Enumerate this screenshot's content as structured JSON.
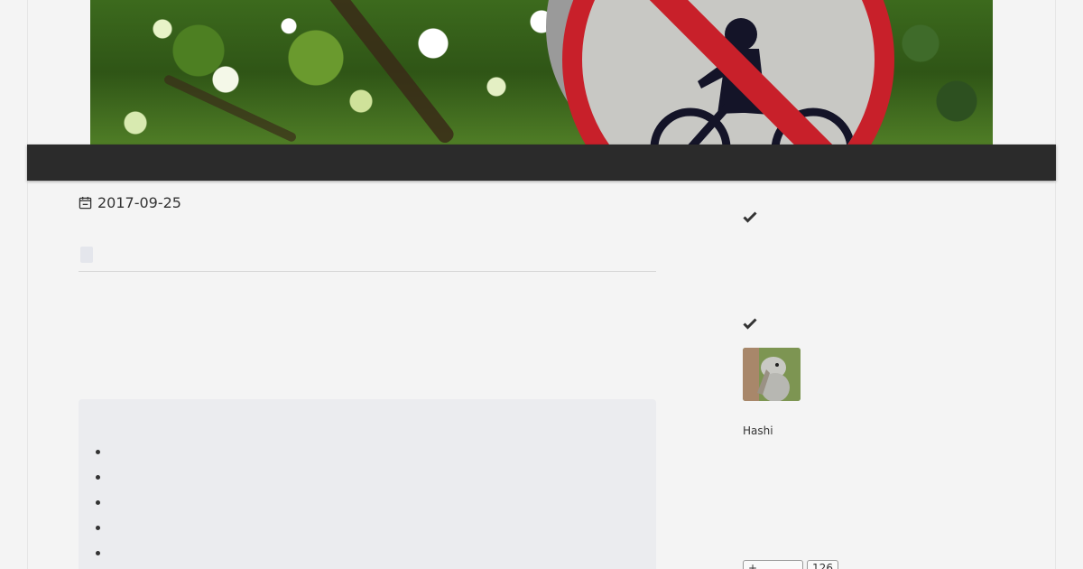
{
  "post": {
    "date": "2017-09-25"
  },
  "toc": {
    "items": [
      "",
      "",
      "",
      "",
      ""
    ]
  },
  "sidebar": {
    "author_name": "Hashi",
    "follow_button_icon": "+",
    "follower_count": "126"
  },
  "colors": {
    "navbar": "#2b2b2b",
    "background": "#f4f4f4",
    "toc_background": "#ebecef",
    "sign_red": "#c8202a"
  },
  "icons": {
    "date": "calendar-icon",
    "section_marker": "check-icon"
  }
}
